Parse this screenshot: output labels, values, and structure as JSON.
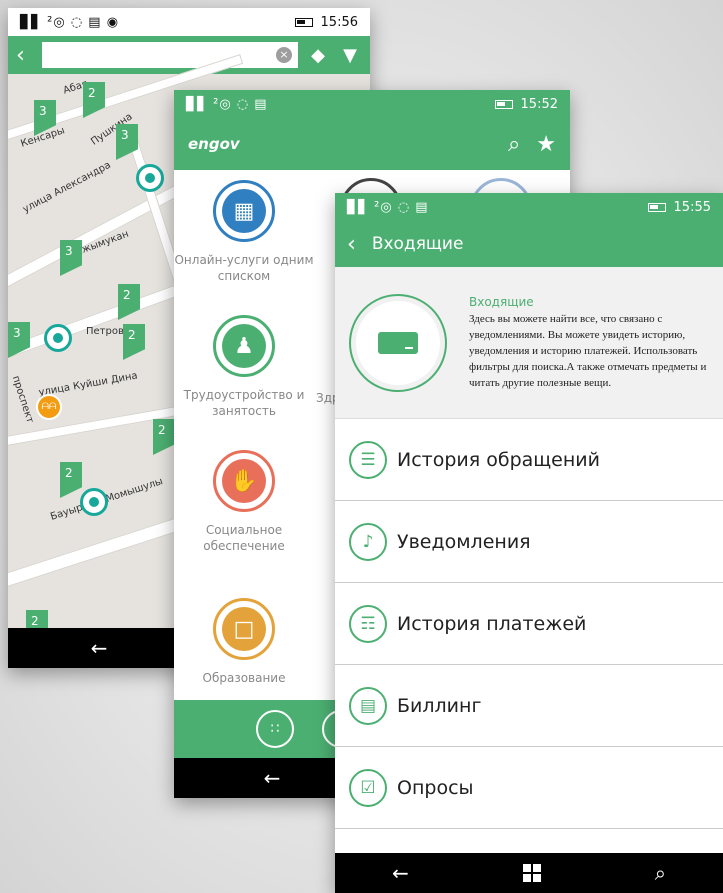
{
  "colors": {
    "accent": "#4caf72",
    "pin": "#18a89b",
    "orange_pin": "#f39c12"
  },
  "phone1": {
    "status": {
      "icons": "▊▋ ²◎ ◌ ▤ ◉",
      "time": "15:56"
    },
    "search": {
      "placeholder": "",
      "clear_icon": "×"
    },
    "streets": [
      "Абая",
      "Кенсары",
      "Пушкина",
      "улица Александра",
      "Кажымукан",
      "Петров",
      "улица Куйши Дина",
      "Бауыржан Момышулы",
      "проспект"
    ],
    "cluster_counts": [
      "2",
      "3",
      "3",
      "3",
      "2",
      "3",
      "2",
      "2",
      "2",
      "2"
    ],
    "pin_label": "ᗩᗩ"
  },
  "phone2": {
    "status": {
      "icons": "▊▋ ²◎ ◌ ▤",
      "time": "15:52"
    },
    "logo": "engov",
    "services": [
      {
        "label": "Онлайн-услуги одним списком",
        "color": "#2f7fc1",
        "icon": "▦"
      },
      {
        "label": "Трудоустройство и занятость",
        "color": "#4caf72",
        "icon": "♟"
      },
      {
        "label": "Социальное обеспечение",
        "color": "#e8705a",
        "icon": "✋"
      },
      {
        "label": "Образование",
        "color": "#e3a33a",
        "icon": "□"
      }
    ],
    "partial_label": "Здр"
  },
  "phone3": {
    "status": {
      "icons": "▊▋ ²◎ ◌ ▤",
      "time": "15:55"
    },
    "title": "Входящие",
    "info": {
      "title": "Входящие",
      "body": "Здесь вы можете найти все, что связано с уведомлениями. Вы можете увидеть историю, уведомления и историю платежей. Использовать фильтры для поиска.А также отмечать предметы и читать другие полезные вещи."
    },
    "menu": [
      {
        "label": "История обращений",
        "icon": "☰"
      },
      {
        "label": "Уведомления",
        "icon": "♪"
      },
      {
        "label": "История платежей",
        "icon": "☶"
      },
      {
        "label": "Биллинг",
        "icon": "▤"
      },
      {
        "label": "Опросы",
        "icon": "☑"
      }
    ]
  }
}
